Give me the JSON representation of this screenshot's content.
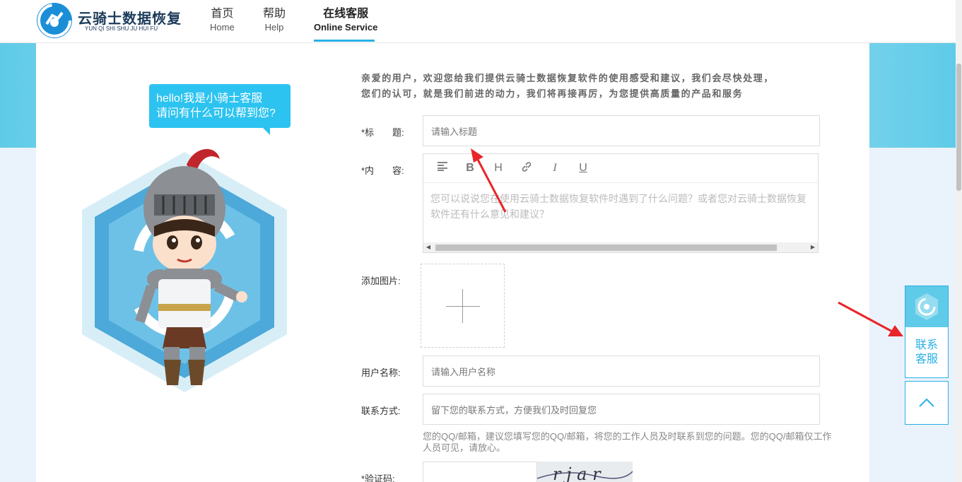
{
  "header": {
    "logo_cn": "云骑士数据恢复",
    "logo_en": "YUN QI SHI SHU JU HUI FU",
    "nav": [
      {
        "cn": "首页",
        "en": "Home"
      },
      {
        "cn": "帮助",
        "en": "Help"
      },
      {
        "cn": "在线客服",
        "en": "Online Service"
      }
    ]
  },
  "mascot": {
    "bubble_line1": "hello!我是小骑士客服",
    "bubble_line2": "请问有什么可以帮到您?"
  },
  "form": {
    "intro_line1": "亲爱的用户，欢迎您给我们提供云骑士数据恢复软件的使用感受和建议，我们会尽快处理，",
    "intro_line2": "您们的认可，就是我们前进的动力，我们将再接再厉，为您提供高质量的产品和服务",
    "title_label": "*标　　题:",
    "title_placeholder": "请输入标题",
    "content_label": "*内　　容:",
    "content_placeholder": "您可以说说您在使用云骑士数据恢复软件时遇到了什么问题？或者您对云骑士数据恢复软件还有什么意见和建议？",
    "image_label": "添加图片:",
    "username_label": "用户名称:",
    "username_placeholder": "请输入用户名称",
    "contact_label": "联系方式:",
    "contact_placeholder": "留下您的联系方式，方便我们及时回复您",
    "hint": "您的QQ/邮箱，建议您填写您的QQ/邮箱，将您的工作人员及时联系到您的问题。您的QQ/邮箱仅工作人员可见，请放心。",
    "captcha_label": "*验证码:",
    "captcha_text": "r j a r"
  },
  "toolbar": {
    "icons": [
      "align-left-icon",
      "bold-icon",
      "heading-icon",
      "link-icon",
      "italic-icon",
      "underline-icon"
    ],
    "bold": "B",
    "heading": "H",
    "italic": "I",
    "underline": "U"
  },
  "float": {
    "service_line1": "联系",
    "service_line2": "客服"
  },
  "colors": {
    "accent": "#2ab0e6",
    "banner": "#5fcbe8",
    "annotation_arrow": "#e8262a"
  }
}
